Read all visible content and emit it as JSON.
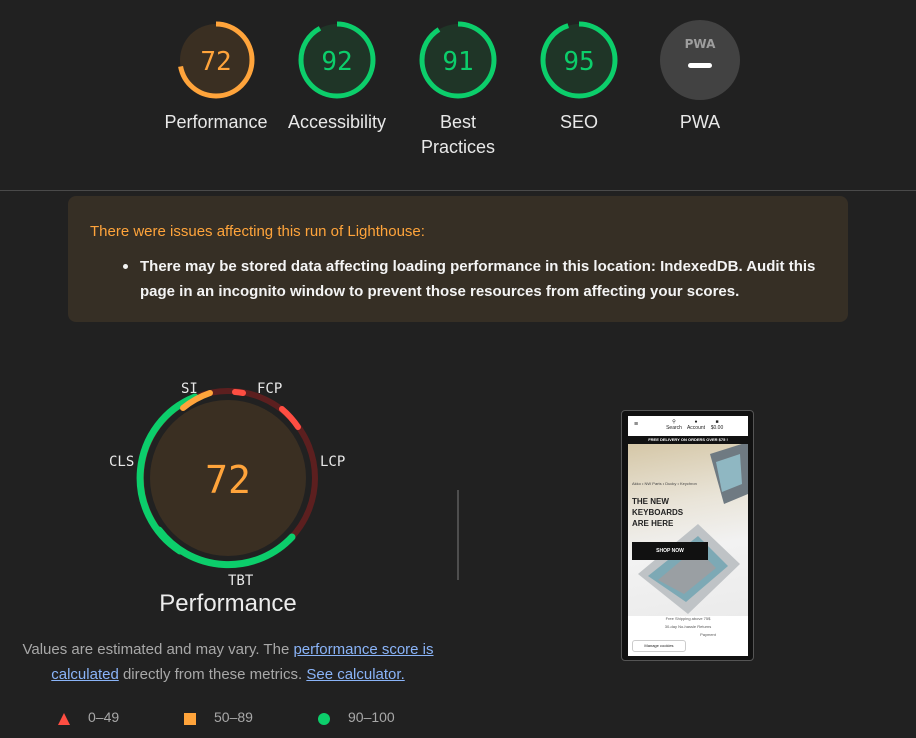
{
  "categories": [
    {
      "label": "Performance",
      "score": "72",
      "value": 72,
      "color": "#ffa43b",
      "bg": "#3a2f22"
    },
    {
      "label": "Accessibility",
      "score": "92",
      "value": 92,
      "color": "#0cce6b",
      "bg": "#1f3527"
    },
    {
      "label": "Best",
      "label2": "Practices",
      "score": "91",
      "value": 91,
      "color": "#0cce6b",
      "bg": "#1f3527"
    },
    {
      "label": "SEO",
      "score": "95",
      "value": 95,
      "color": "#0cce6b",
      "bg": "#1f3527"
    },
    {
      "label": "PWA",
      "score": "PWA",
      "value": null,
      "color": "#cccccc",
      "bg": "#424242",
      "icon": "pwa-icon"
    }
  ],
  "warning": {
    "title": "There were issues affecting this run of Lighthouse:",
    "items": [
      "There may be stored data affecting loading performance in this location: IndexedDB. Audit this page in an incognito window to prevent those resources from affecting your scores."
    ]
  },
  "performance": {
    "score": "72",
    "title": "Performance",
    "metrics": {
      "si": "SI",
      "fcp": "FCP",
      "lcp": "LCP",
      "tbt": "TBT",
      "cls": "CLS"
    }
  },
  "description": {
    "text1": "Values are estimated and may vary. The ",
    "link1": "performance score is calculated",
    "text2": " directly from these metrics. ",
    "link2": "See calculator."
  },
  "legend": [
    {
      "label": "0–49",
      "color": "#ff4e42",
      "shape": "triangle"
    },
    {
      "label": "50–89",
      "color": "#ffa43b",
      "shape": "square"
    },
    {
      "label": "90–100",
      "color": "#0cce6b",
      "shape": "circle"
    }
  ],
  "screenshot": {
    "nav": {
      "search": "Search",
      "account": "Account",
      "cart": "$0.00"
    },
    "banner": "FREE DELIVERY ON ORDERS OVER $75 !",
    "breadcrumb": "Akko • NW Parts • Ducky • Keychron",
    "headline_lines": [
      "THE NEW",
      "KEYBOARDS",
      "ARE HERE"
    ],
    "cta": "SHOP NOW",
    "footer1": "Free Shipping above 75$",
    "footer2": "30-day No-hassle Returns",
    "footer3": "Payment",
    "cookie": "Manage cookies"
  }
}
